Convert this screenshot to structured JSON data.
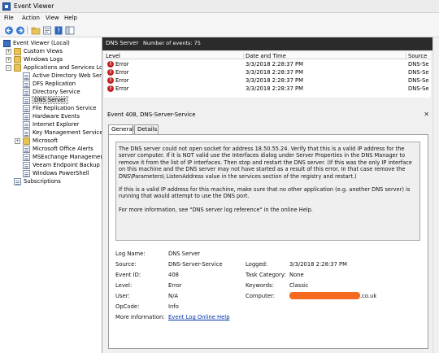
{
  "window": {
    "title": "Event Viewer"
  },
  "menu": [
    "File",
    "Action",
    "View",
    "Help"
  ],
  "toolbar": {
    "buttons": [
      "back-icon",
      "forward-icon",
      "folder-up-icon",
      "properties-icon",
      "help-icon",
      "panel-icon"
    ]
  },
  "tree": {
    "root": "Event Viewer (Local)",
    "custom_views": "Custom Views",
    "windows_logs": "Windows Logs",
    "apps_services": "Applications and Services Logs",
    "children": [
      "Active Directory Web Service",
      "DFS Replication",
      "Directory Service",
      "DNS Server",
      "File Replication Service",
      "Hardware Events",
      "Internet Explorer",
      "Key Management Service",
      "Microsoft",
      "Microsoft Office Alerts",
      "MSExchange Management",
      "Veeam Endpoint Backup",
      "Windows PowerShell"
    ],
    "subscriptions": "Subscriptions",
    "selected": "DNS Server"
  },
  "events_panel": {
    "log_name": "DNS Server",
    "count_text": "Number of events: 75",
    "columns": [
      "Level",
      "Date and Time",
      "Source"
    ],
    "rows": [
      {
        "level": "Error",
        "datetime": "3/3/2018 2:28:37 PM",
        "source": "DNS-Se"
      },
      {
        "level": "Error",
        "datetime": "3/3/2018 2:28:37 PM",
        "source": "DNS-Se"
      },
      {
        "level": "Error",
        "datetime": "3/3/2018 2:28:37 PM",
        "source": "DNS-Se"
      },
      {
        "level": "Error",
        "datetime": "3/3/2018 2:28:37 PM",
        "source": "DNS-Se"
      }
    ]
  },
  "detail": {
    "title": "Event 408, DNS-Server-Service",
    "tabs": [
      "General",
      "Details"
    ],
    "message": {
      "p1": "The DNS server could not open socket for address 18.50.55.24. Verify that this is a valid IP address for the server computer.  If it is NOT valid use the Interfaces dialog under Server Properties in the DNS Manager to remove it from the list of IP interfaces.  Then stop and restart the DNS server. (If this was the only IP interface on this machine and the DNS server may not have started as a result of this error.  In that case remove the DNS\\Parameters\\ ListenAddress value in the services section of the registry and restart.)",
      "p2": "If this is a valid IP address for this machine, make sure that no other application (e.g. another DNS server) is running that would attempt to use the DNS port.",
      "p3": "For more information, see \"DNS server log reference\" in the online Help."
    },
    "props": {
      "log_name_label": "Log Name:",
      "log_name": "DNS Server",
      "source_label": "Source:",
      "source": "DNS-Server-Service",
      "logged_label": "Logged:",
      "logged": "3/3/2018 2:28:37 PM",
      "event_id_label": "Event ID:",
      "event_id": "408",
      "task_category_label": "Task Category:",
      "task_category": "None",
      "level_label": "Level:",
      "level": "Error",
      "keywords_label": "Keywords:",
      "keywords": "Classic",
      "user_label": "User:",
      "user": "N/A",
      "computer_label": "Computer:",
      "computer_suffix": ".co.uk",
      "opcode_label": "OpCode:",
      "opcode": "Info",
      "more_info_label": "More Information:",
      "more_info_link": "Event Log Online Help"
    }
  },
  "colors": {
    "error": "#c22222",
    "header_bg": "#2b2b2b",
    "redaction": "#f56a20",
    "link": "#0033aa"
  }
}
